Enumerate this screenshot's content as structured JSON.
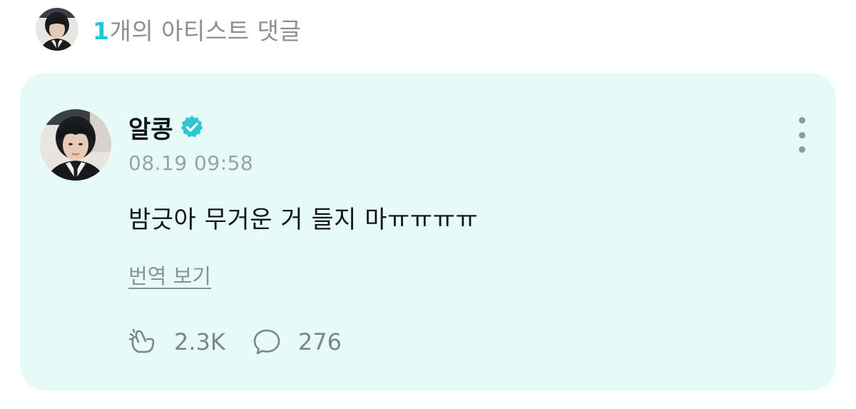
{
  "header": {
    "avatar": "artist-avatar",
    "count": "1",
    "title_suffix": "개의 아티스트 댓글"
  },
  "comment": {
    "author": "알콩",
    "verified_icon": "verified-badge-icon",
    "timestamp": "08.19 09:58",
    "body": "밤긋아 무거운 거 들지 마ㅠㅠㅠㅠ",
    "translate_label": "번역 보기",
    "more_icon": "more-vertical-icon",
    "stats": {
      "likes_icon": "cheer-hand-icon",
      "likes": "2.3K",
      "replies_icon": "speech-bubble-icon",
      "replies": "276"
    }
  },
  "colors": {
    "accent": "#1fc8d2",
    "card_bg": "#e6fbf8",
    "verified": "#31c7d1",
    "muted_text": "#8a8e95"
  }
}
